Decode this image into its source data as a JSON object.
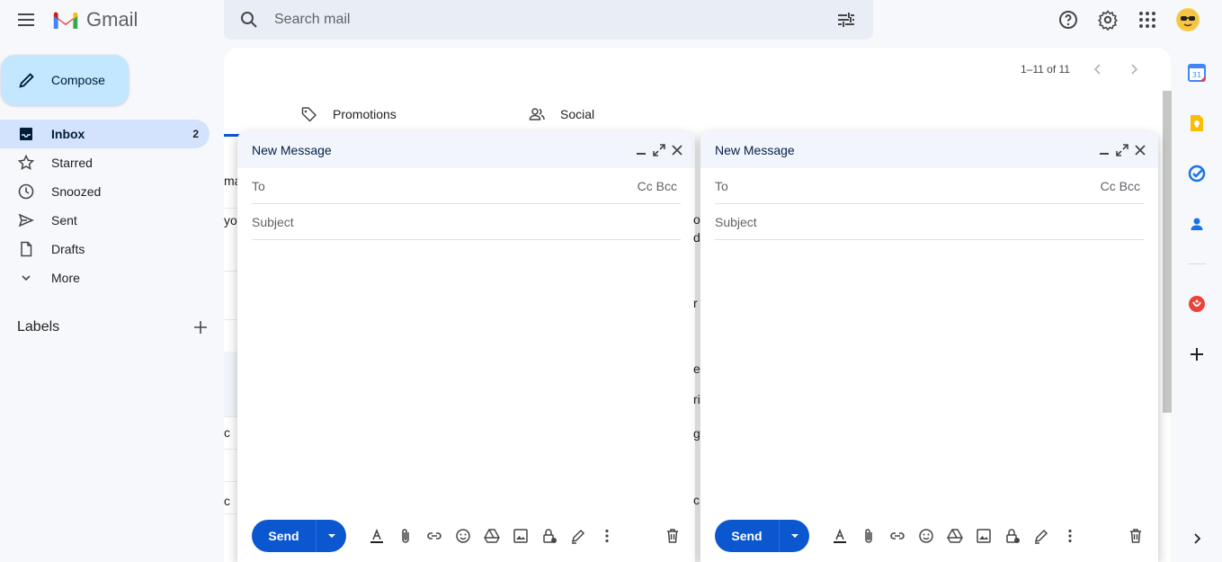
{
  "header": {
    "app_name": "Gmail",
    "search_placeholder": "Search mail"
  },
  "sidebar": {
    "compose_label": "Compose",
    "items": [
      {
        "label": "Inbox",
        "count": "2",
        "icon": "inbox-icon"
      },
      {
        "label": "Starred",
        "count": "",
        "icon": "star-icon"
      },
      {
        "label": "Snoozed",
        "count": "",
        "icon": "clock-icon"
      },
      {
        "label": "Sent",
        "count": "",
        "icon": "send-icon"
      },
      {
        "label": "Drafts",
        "count": "",
        "icon": "draft-icon"
      },
      {
        "label": "More",
        "count": "",
        "icon": "chevron-down-icon"
      }
    ],
    "labels_title": "Labels"
  },
  "main": {
    "pager_text": "1–11 of 11",
    "tabs": [
      {
        "label": "Promotions",
        "icon": "tag-icon"
      },
      {
        "label": "Social",
        "icon": "people-icon"
      }
    ],
    "peek_fragments": [
      "ma",
      "yo",
      "c",
      "c"
    ],
    "peek_fragments_right": [
      "o",
      "d",
      "r",
      "e",
      "ri",
      "g",
      "c"
    ]
  },
  "compose_windows": [
    {
      "title": "New Message",
      "to_label": "To",
      "cc_bcc": "Cc Bcc",
      "subject_placeholder": "Subject",
      "send_label": "Send"
    },
    {
      "title": "New Message",
      "to_label": "To",
      "cc_bcc": "Cc Bcc",
      "subject_placeholder": "Subject",
      "send_label": "Send"
    }
  ],
  "colors": {
    "accent": "#0b57d0",
    "compose_bg": "#c2e7ff",
    "active_nav": "#d3e3fd",
    "background": "#f6f8fc"
  }
}
